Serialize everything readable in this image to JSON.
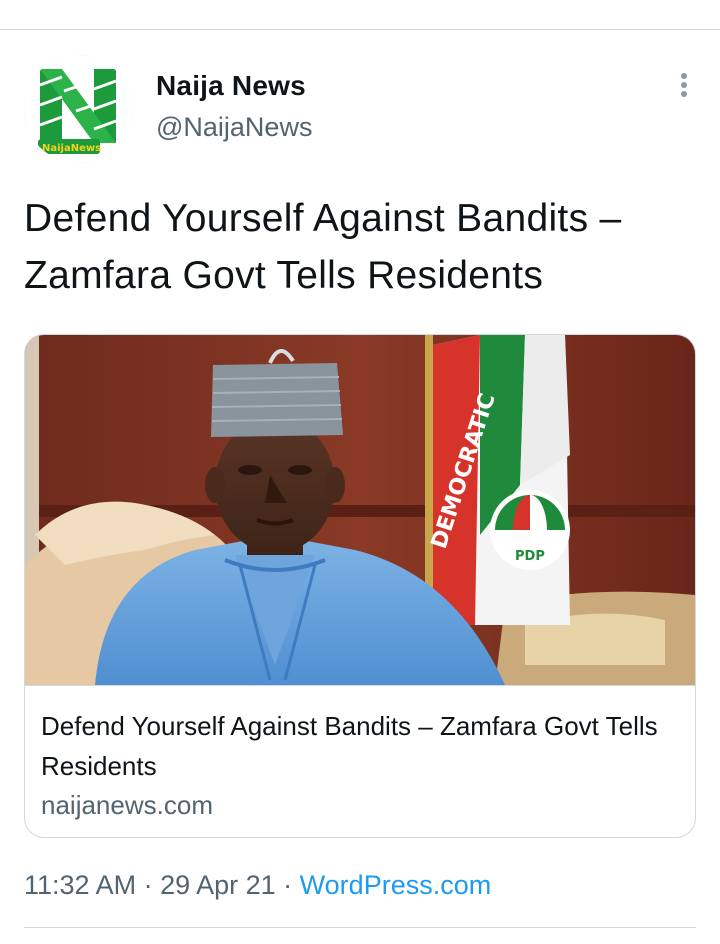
{
  "author": {
    "display_name": "Naija News",
    "handle": "@NaijaNews",
    "avatar_logo_text": "NaijaNews",
    "brand_green": "#1c9a3c"
  },
  "tweet": {
    "text": "Defend Yourself Against Bandits – Zamfara Govt Tells Residents"
  },
  "card": {
    "image_subject": "man-in-blue-agbada-with-flag",
    "flag_text": "DEMOCRATIC",
    "flag_badge_text": "PDP",
    "title": "Defend Yourself Against Bandits – Zamfara Govt Tells Residents",
    "domain": "naijanews.com"
  },
  "meta": {
    "time": "11:32 AM",
    "separator_1": " · ",
    "date": "29 Apr 21",
    "separator_2": " · ",
    "source": "WordPress.com"
  },
  "icons": {
    "more": "more-vertical-icon"
  },
  "colors": {
    "text_primary": "#0f1419",
    "text_secondary": "#536471",
    "link": "#1d9bf0",
    "border": "#cfd9de"
  }
}
